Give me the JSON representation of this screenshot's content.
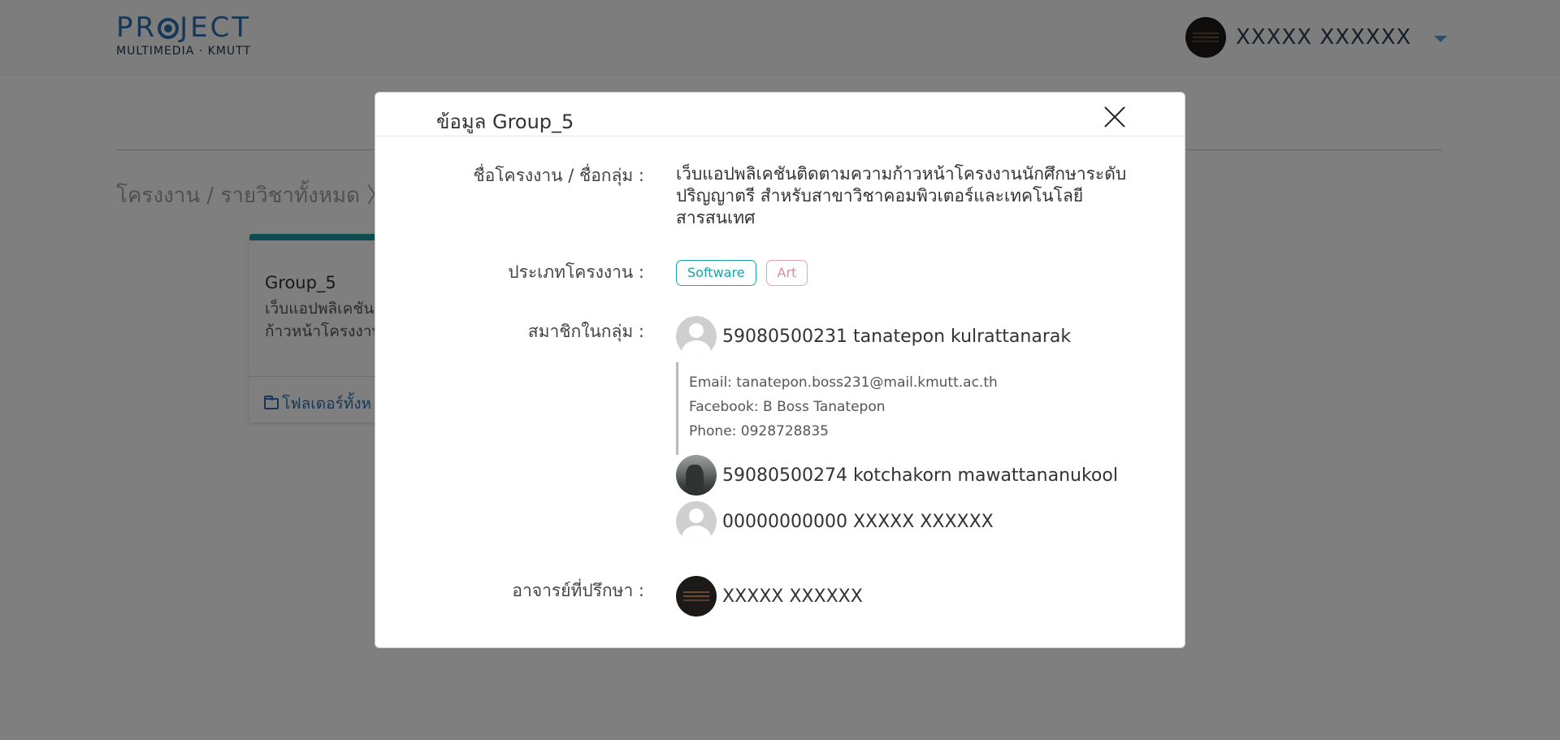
{
  "header": {
    "logo_main_left": "PR",
    "logo_main_right": "JECT",
    "logo_sub": "MULTIMEDIA · KMUTT",
    "user_name": "XXXXX XXXXXX"
  },
  "background": {
    "breadcrumb": "โครงงาน / รายวิชาทั้งหมด 〉",
    "card": {
      "title": "Group_5",
      "desc_line1": "เว็บแอปพลิเคชัน",
      "desc_line2": "ก้าวหน้าโครงงาน",
      "folder_label": "โฟลเดอร์ทั้งห"
    }
  },
  "modal": {
    "title": "ข้อมูล Group_5",
    "labels": {
      "project_name": "ชื่อโครงงาน / ชื่อกลุ่ม :",
      "project_type": "ประเภทโครงงาน :",
      "members": "สมาชิกในกลุ่ม :",
      "advisor": "อาจารย์ที่ปรึกษา :"
    },
    "project_name": "เว็บแอปพลิเคชันติดตามความก้าวหน้าโครงงานนักศึกษาระดับปริญญาตรี สำหรับสาขาวิชาคอมพิวเตอร์และเทคโนโลยีสารสนเทศ",
    "tags": [
      "Software",
      "Art"
    ],
    "members": [
      {
        "name": "59080500231 tanatepon kulrattanarak",
        "email": "Email: tanatepon.boss231@mail.kmutt.ac.th",
        "facebook": "Facebook: B Boss Tanatepon",
        "phone": "Phone: 0928728835"
      },
      {
        "name": "59080500274 kotchakorn mawattananukool"
      },
      {
        "name": "00000000000 XXXXX XXXXXX"
      }
    ],
    "advisor": "XXXXX XXXXXX"
  },
  "colors": {
    "software_tag": "#1aa3a8",
    "art_tag": "#e08c98",
    "card_accent": "#1a9aa0",
    "brand_blue": "#2f6fb0"
  },
  "icons": [
    "close-icon",
    "caret-down-icon",
    "folder-icon",
    "default-avatar-icon"
  ]
}
